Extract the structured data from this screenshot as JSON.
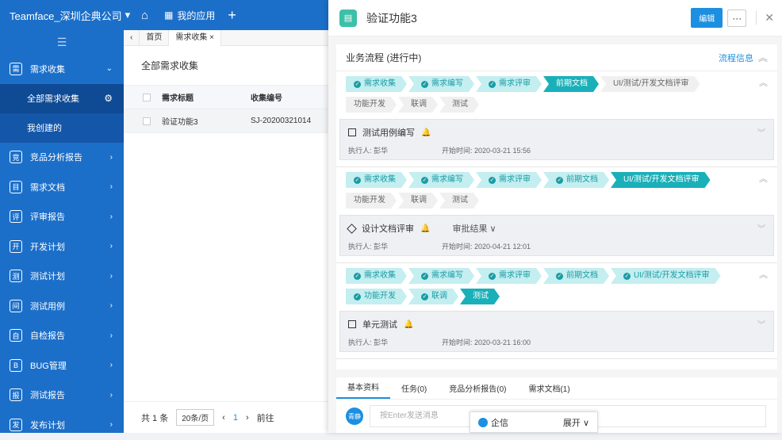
{
  "topbar": {
    "brand": "Teamface_深圳企典公司",
    "apps_label": "我的应用"
  },
  "sidebar": {
    "items": [
      {
        "label": "需求收集",
        "icon": "需"
      },
      {
        "label": "竞品分析报告",
        "icon": "竞"
      },
      {
        "label": "需求文档",
        "icon": "目"
      },
      {
        "label": "评审报告",
        "icon": "评"
      },
      {
        "label": "开发计划",
        "icon": "开"
      },
      {
        "label": "测试计划",
        "icon": "测"
      },
      {
        "label": "测试用例",
        "icon": "间"
      },
      {
        "label": "自检报告",
        "icon": "自"
      },
      {
        "label": "BUG管理",
        "icon": "B"
      },
      {
        "label": "测试报告",
        "icon": "报"
      },
      {
        "label": "发布计划",
        "icon": "发"
      }
    ],
    "subitems": [
      "全部需求收集",
      "我创建的"
    ]
  },
  "main": {
    "tabs": [
      "首页",
      "需求收集 ×"
    ],
    "title": "全部需求收集",
    "columns": [
      "需求标题",
      "收集编号"
    ],
    "rows": [
      [
        "验证功能3",
        "SJ-20200321014"
      ]
    ],
    "footer": {
      "total": "共 1 条",
      "page_size": "20条/页",
      "page": "1",
      "goto": "前往"
    }
  },
  "panel": {
    "title": "验证功能3",
    "edit": "编辑",
    "more": "···",
    "workflow_title": "业务流程 (进行中)",
    "workflow_info": "流程信息",
    "stages": [
      {
        "steps": [
          [
            "需求收集",
            "done"
          ],
          [
            "需求编写",
            "done"
          ],
          [
            "需求评审",
            "done"
          ],
          [
            "前期文档",
            "cur"
          ],
          [
            "UI/测试/开发文档评审",
            "todo"
          ],
          [
            "功能开发",
            "todo"
          ],
          [
            "联调",
            "todo"
          ],
          [
            "测试",
            "todo"
          ]
        ],
        "task": {
          "shape": "box",
          "name": "测试用例编写",
          "extra": "",
          "executor": "执行人: 彭华",
          "time": "开始时间: 2020-03-21 15:56"
        }
      },
      {
        "steps": [
          [
            "需求收集",
            "done"
          ],
          [
            "需求编写",
            "done"
          ],
          [
            "需求评审",
            "done"
          ],
          [
            "前期文档",
            "done"
          ],
          [
            "UI/测试/开发文档评审",
            "cur"
          ],
          [
            "功能开发",
            "todo"
          ],
          [
            "联调",
            "todo"
          ],
          [
            "测试",
            "todo"
          ]
        ],
        "task": {
          "shape": "diamond",
          "name": "设计文档评审",
          "extra": "审批结果 ∨",
          "executor": "执行人: 彭华",
          "time": "开始时间: 2020-04-21 12:01"
        }
      },
      {
        "steps": [
          [
            "需求收集",
            "done"
          ],
          [
            "需求编写",
            "done"
          ],
          [
            "需求评审",
            "done"
          ],
          [
            "前期文档",
            "done"
          ],
          [
            "UI/测试/开发文档评审",
            "done"
          ],
          [
            "功能开发",
            "done"
          ],
          [
            "联调",
            "done"
          ],
          [
            "测试",
            "cur"
          ]
        ],
        "task": {
          "shape": "box",
          "name": "单元测试",
          "extra": "",
          "executor": "执行人: 彭华",
          "time": "开始时间: 2020-03-21 16:00"
        }
      }
    ],
    "bottom_tabs": [
      "基本资料",
      "任务(0)",
      "竞品分析报告(0)",
      "需求文档(1)"
    ],
    "chat": {
      "avatar": "青静",
      "placeholder": "按Enter发送消息"
    }
  },
  "qixin": {
    "label": "企信",
    "expand": "展开 ∨"
  },
  "colors": {
    "primary": "#1c6fc9",
    "teal": "#19b0b9",
    "edit": "#1c8fe0"
  }
}
